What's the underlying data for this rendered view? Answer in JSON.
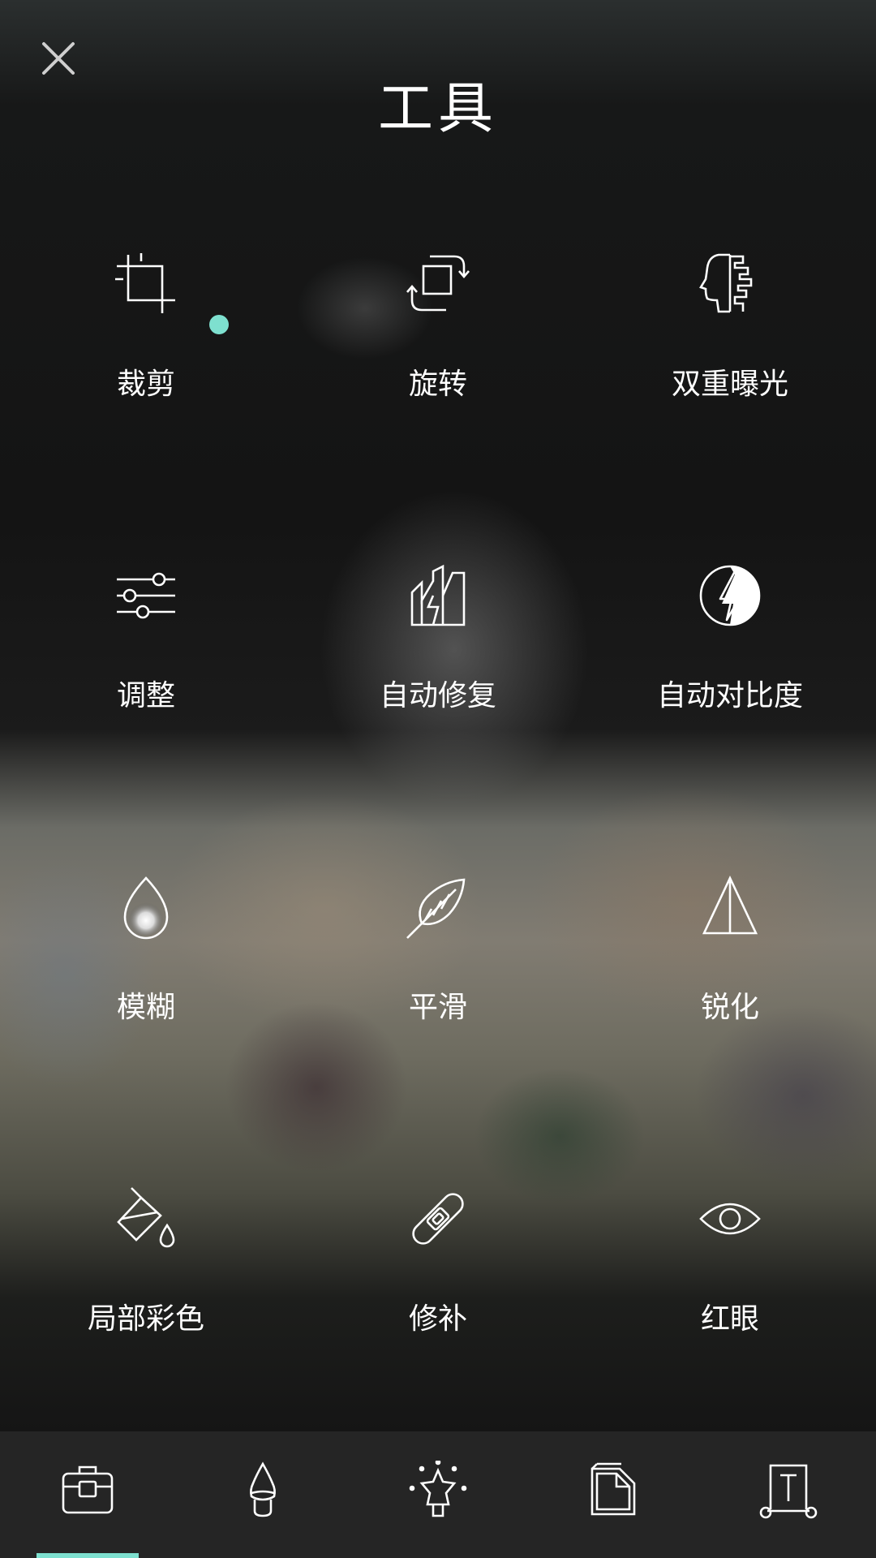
{
  "title": "工具",
  "colors": {
    "accent": "#7ee0cf",
    "icon": "#ffffff",
    "bar_bg": "#252525"
  },
  "close_icon": "close-icon",
  "tools": [
    {
      "label": "裁剪",
      "icon": "crop-icon"
    },
    {
      "label": "旋转",
      "icon": "rotate-icon"
    },
    {
      "label": "双重曝光",
      "icon": "double-exposure-icon"
    },
    {
      "label": "调整",
      "icon": "adjust-sliders-icon",
      "has_new_badge": true
    },
    {
      "label": "自动修复",
      "icon": "auto-fix-icon"
    },
    {
      "label": "自动对比度",
      "icon": "auto-contrast-icon"
    },
    {
      "label": "模糊",
      "icon": "blur-drop-icon"
    },
    {
      "label": "平滑",
      "icon": "smooth-feather-icon"
    },
    {
      "label": "锐化",
      "icon": "sharpen-icon"
    },
    {
      "label": "局部彩色",
      "icon": "selective-color-icon"
    },
    {
      "label": "修补",
      "icon": "heal-bandage-icon"
    },
    {
      "label": "红眼",
      "icon": "red-eye-icon"
    }
  ],
  "bottom_tabs": [
    {
      "icon": "tools-toolbox-icon",
      "selected": true
    },
    {
      "icon": "effects-brush-icon",
      "selected": false
    },
    {
      "icon": "stickers-star-icon",
      "selected": false
    },
    {
      "icon": "frames-page-icon",
      "selected": false
    },
    {
      "icon": "text-icon",
      "selected": false
    }
  ]
}
